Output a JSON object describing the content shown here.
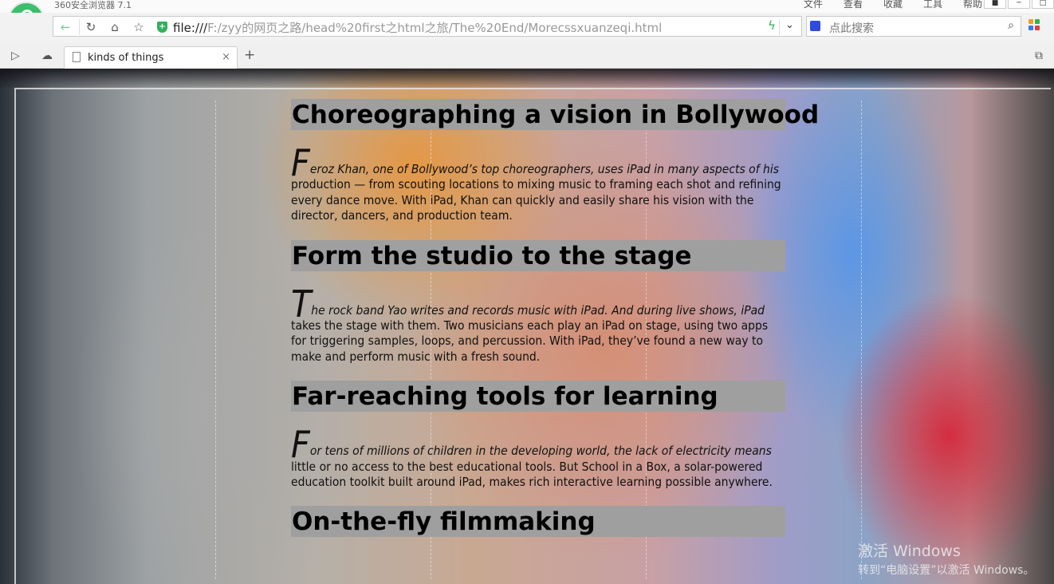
{
  "browser": {
    "app_title": "360安全浏览器 7.1",
    "menu": [
      "文件",
      "查看",
      "收藏",
      "工具",
      "帮助"
    ],
    "url_scheme": "file:///",
    "url_rest": "F:/zyy的网页之路/head%20first之html之旅/The%20End/Morecssxuanzeqi.html",
    "search_placeholder": "点此搜索",
    "tab_title": "kinds of things",
    "colors": {
      "accent_green": "#35b34a",
      "alert_red": "#e02424"
    }
  },
  "article": {
    "sections": [
      {
        "heading": "Choreographing a vision in Bollywood",
        "drop": "F",
        "lead": "eroz Khan, one of Bollywood’s top choreographers, uses iPad in many aspects of his",
        "body": "production — from scouting locations to mixing music to framing each shot and refining every dance move. With iPad, Khan can quickly and easily share his vision with the director, dancers, and production team."
      },
      {
        "heading": "Form the studio to the stage",
        "drop": "T",
        "lead": "he rock band Yao writes and records music with iPad. And during live shows, iPad",
        "body": "takes the stage with them. Two musicians each play an iPad on stage, using two apps for triggering samples, loops, and percussion. With iPad, they’ve found a new way to make and perform music with a fresh sound."
      },
      {
        "heading": "Far-reaching tools for learning",
        "drop": "F",
        "lead": "or tens of millions of children in the developing world, the lack of electricity means",
        "body": "little or no access to the best educational tools. But School in a Box, a solar-powered education toolkit built around iPad, makes rich interactive learning possible anywhere."
      },
      {
        "heading": "On-the-fly filmmaking"
      }
    ]
  },
  "os_watermark": {
    "line1": "激活 Windows",
    "line2": "转到“电脑设置”以激活 Windows。"
  }
}
